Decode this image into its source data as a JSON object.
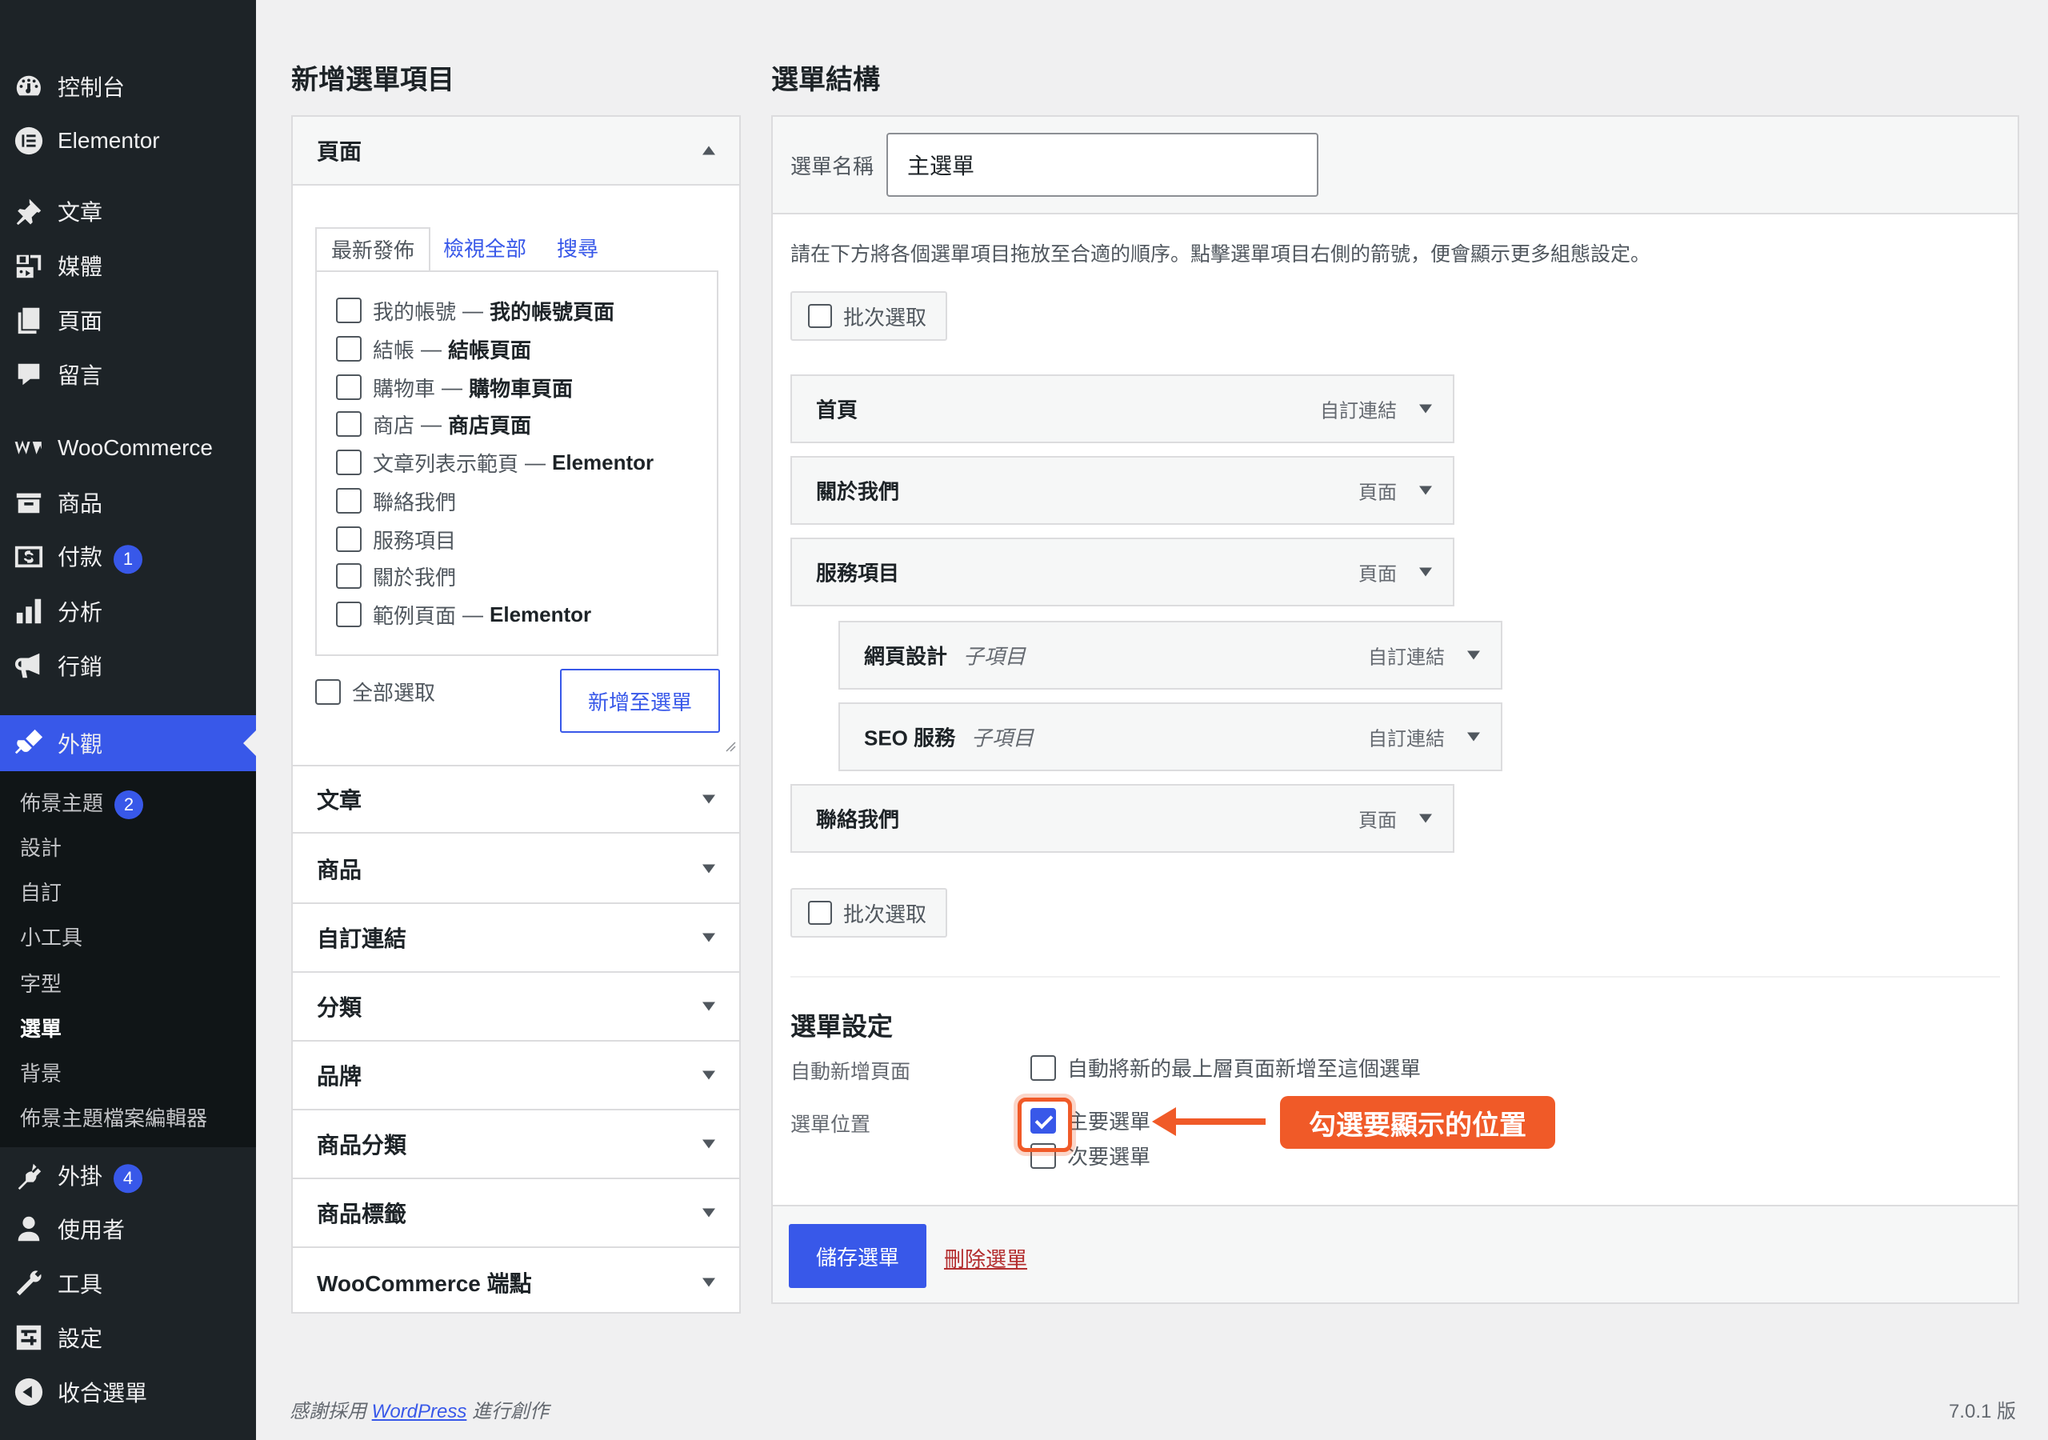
{
  "sidebar": {
    "items": [
      {
        "icon": "dashboard-icon",
        "label": "控制台"
      },
      {
        "icon": "elementor-icon",
        "label": "Elementor"
      },
      {
        "icon": "pin-icon",
        "label": "文章"
      },
      {
        "icon": "media-icon",
        "label": "媒體"
      },
      {
        "icon": "pages-icon",
        "label": "頁面"
      },
      {
        "icon": "comments-icon",
        "label": "留言"
      },
      {
        "icon": "woocommerce-icon",
        "label": "WooCommerce"
      },
      {
        "icon": "products-icon",
        "label": "商品"
      },
      {
        "icon": "payments-icon",
        "label": "付款",
        "badge": "1"
      },
      {
        "icon": "analytics-icon",
        "label": "分析"
      },
      {
        "icon": "megaphone-icon",
        "label": "行銷"
      },
      {
        "icon": "appearance-icon",
        "label": "外觀"
      },
      {
        "icon": "plugins-icon",
        "label": "外掛",
        "badge": "4"
      },
      {
        "icon": "users-icon",
        "label": "使用者"
      },
      {
        "icon": "tools-icon",
        "label": "工具"
      },
      {
        "icon": "settings-icon",
        "label": "設定"
      },
      {
        "icon": "collapse-icon",
        "label": "收合選單"
      }
    ],
    "submenu": [
      {
        "label": "佈景主題",
        "badge": "2"
      },
      {
        "label": "設計"
      },
      {
        "label": "自訂"
      },
      {
        "label": "小工具"
      },
      {
        "label": "字型"
      },
      {
        "label": "選單",
        "current": true
      },
      {
        "label": "背景"
      },
      {
        "label": "佈景主題檔案編輯器"
      }
    ]
  },
  "add_items": {
    "heading": "新增選單項目",
    "pages_section": {
      "title": "頁面",
      "tabs": [
        "最新發佈",
        "檢視全部",
        "搜尋"
      ],
      "pages": [
        {
          "name": "我的帳號",
          "state": "我的帳號頁面"
        },
        {
          "name": "結帳",
          "state": "結帳頁面"
        },
        {
          "name": "購物車",
          "state": "購物車頁面"
        },
        {
          "name": "商店",
          "state": "商店頁面"
        },
        {
          "name": "文章列表示範頁",
          "state": "Elementor"
        },
        {
          "name": "聯絡我們",
          "state": ""
        },
        {
          "name": "服務項目",
          "state": ""
        },
        {
          "name": "關於我們",
          "state": ""
        },
        {
          "name": "範例頁面",
          "state": "Elementor"
        }
      ],
      "separator": "—",
      "select_all": "全部選取",
      "add_button": "新增至選單"
    },
    "sections": [
      "文章",
      "商品",
      "自訂連結",
      "分類",
      "品牌",
      "商品分類",
      "商品標籤",
      "WooCommerce 端點"
    ]
  },
  "structure": {
    "heading": "選單結構",
    "menu_name_label": "選單名稱",
    "menu_name_value": "主選單",
    "instructions": "請在下方將各個選單項目拖放至合適的順序。點擊選單項目右側的箭號，便會顯示更多組態設定。",
    "bulk_select": "批次選取",
    "items": [
      {
        "title": "首頁",
        "sub": "",
        "type": "自訂連結"
      },
      {
        "title": "關於我們",
        "sub": "",
        "type": "頁面"
      },
      {
        "title": "服務項目",
        "sub": "",
        "type": "頁面"
      },
      {
        "title": "網頁設計",
        "sub": "子項目",
        "type": "自訂連結"
      },
      {
        "title": "SEO 服務",
        "sub": "子項目",
        "type": "自訂連結"
      },
      {
        "title": "聯絡我們",
        "sub": "",
        "type": "頁面"
      }
    ],
    "settings": {
      "title": "選單設定",
      "auto_add_label": "自動新增頁面",
      "auto_add_option": "自動將新的最上層頁面新增至這個選單",
      "location_label": "選單位置",
      "primary": "主要選單",
      "secondary": "次要選單",
      "primary_checked": true
    },
    "callout": "勾選要顯示的位置",
    "save_button": "儲存選單",
    "delete_link": "刪除選單"
  },
  "footer": {
    "thanks_prefix": "感謝採用",
    "thanks_link": "WordPress",
    "thanks_suffix": "進行創作",
    "version": "7.0.1 版"
  },
  "colors": {
    "accent": "#3858e9",
    "sidebar": "#1d2327",
    "callout": "#f05a28",
    "delete": "#b32d2e"
  }
}
